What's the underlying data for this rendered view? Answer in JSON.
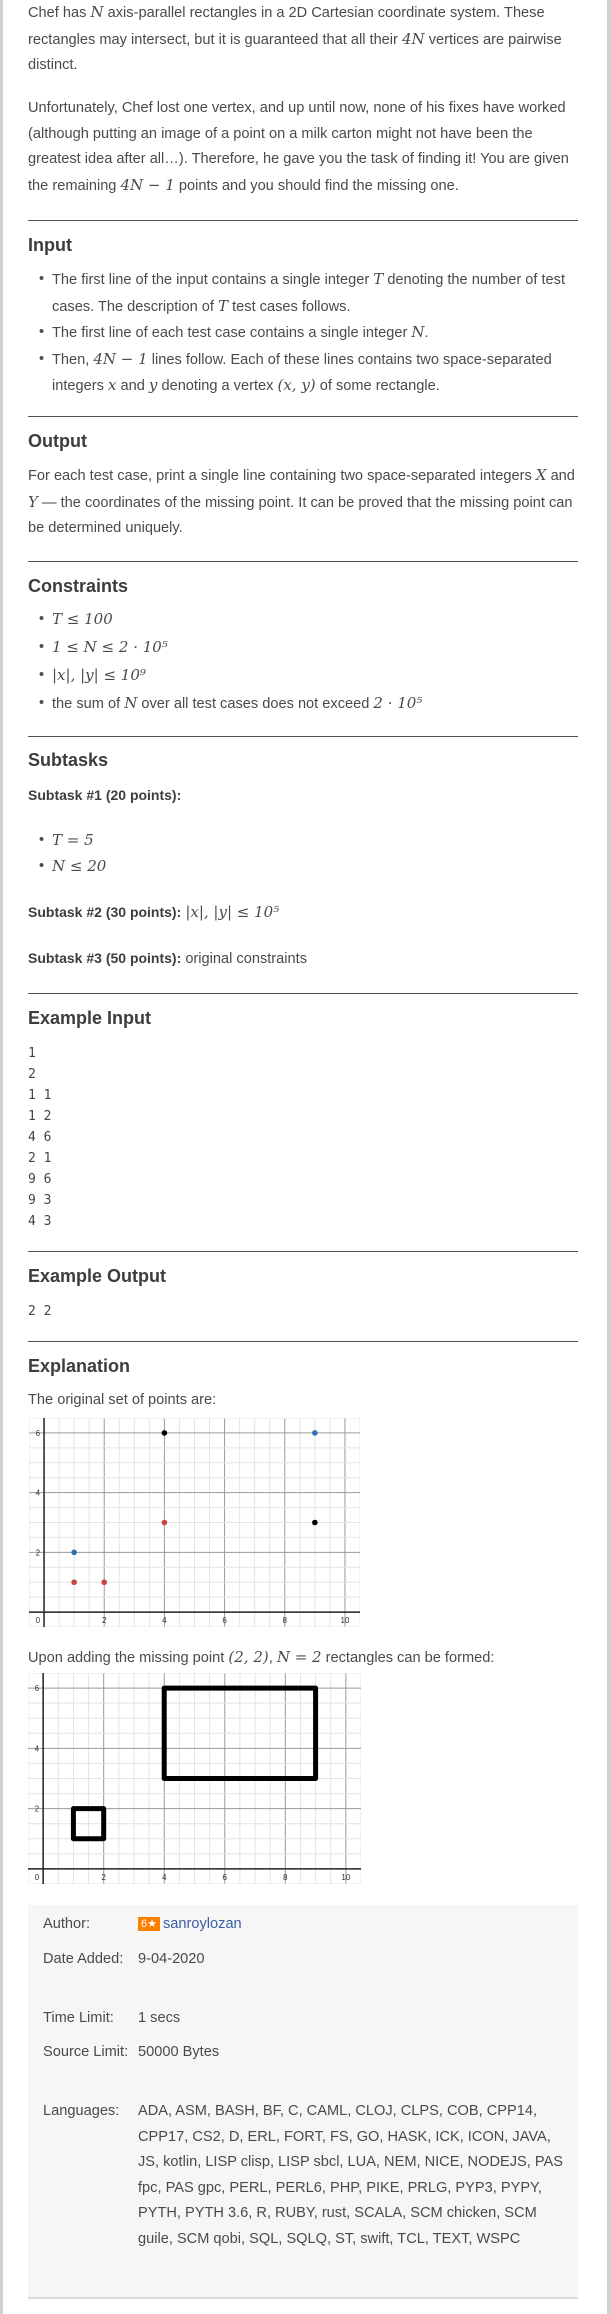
{
  "intro": {
    "p1": [
      "Chef has ",
      {
        "m": "N"
      },
      " axis-parallel rectangles in a 2D Cartesian coordinate system. These rectangles may intersect, but it is guaranteed that all their ",
      {
        "m": "4N"
      },
      " vertices are pairwise distinct."
    ],
    "p2": [
      "Unfortunately, Chef lost one vertex, and up until now, none of his fixes have worked (although putting an image of a point on a milk carton might not have been the greatest idea after all…). Therefore, he gave you the task of finding it! You are given the remaining ",
      {
        "m": "4N − 1"
      },
      " points and you should find the missing one."
    ]
  },
  "input": {
    "heading": "Input",
    "items": [
      [
        "The first line of the input contains a single integer ",
        {
          "m": "T"
        },
        " denoting the number of test cases. The description of ",
        {
          "m": "T"
        },
        " test cases follows."
      ],
      [
        "The first line of each test case contains a single integer ",
        {
          "m": "N"
        },
        "."
      ],
      [
        "Then, ",
        {
          "m": "4N − 1"
        },
        " lines follow. Each of these lines contains two space-separated integers ",
        {
          "m": "x"
        },
        " and ",
        {
          "m": "y"
        },
        " denoting a vertex ",
        {
          "m": "(x, y)"
        },
        " of some rectangle."
      ]
    ]
  },
  "output": {
    "heading": "Output",
    "p": [
      "For each test case, print a single line containing two space-separated integers ",
      {
        "m": "X"
      },
      " and ",
      {
        "m": "Y"
      },
      " — the coordinates of the missing point. It can be proved that the missing point can be determined uniquely."
    ]
  },
  "constraints": {
    "heading": "Constraints",
    "items": [
      [
        {
          "m": "T ≤ 100"
        }
      ],
      [
        {
          "m": "1 ≤ N ≤ 2 · 10⁵"
        }
      ],
      [
        {
          "m": "|x|, |y| ≤ 10⁹"
        }
      ],
      [
        "the sum of ",
        {
          "m": "N"
        },
        " over all test cases does not exceed ",
        {
          "m": "2 · 10⁵"
        }
      ]
    ]
  },
  "subtasks": {
    "heading": "Subtasks",
    "s1": {
      "label": "Subtask #1 (20 points):",
      "items": [
        [
          {
            "m": "T = 5"
          }
        ],
        [
          {
            "m": "N ≤ 20"
          }
        ]
      ]
    },
    "s2": {
      "label": "Subtask #2 (30 points):",
      "text": [
        " ",
        {
          "m": "|x|, |y| ≤ 10⁵"
        }
      ]
    },
    "s3": {
      "label": "Subtask #3 (50 points):",
      "text": [
        " original constraints"
      ]
    }
  },
  "example_input": {
    "heading": "Example Input",
    "text": "1\n2\n1 1\n1 2\n4 6\n2 1\n9 6\n9 3\n4 3"
  },
  "example_output": {
    "heading": "Example Output",
    "text": "2 2"
  },
  "explanation": {
    "heading": "Explanation",
    "p1": [
      "The original set of points are:"
    ],
    "p2": [
      "Upon adding the missing point ",
      {
        "m": "(2, 2)"
      },
      ", ",
      {
        "m": "N = 2"
      },
      " rectangles can be formed:"
    ]
  },
  "chart_data": [
    {
      "type": "scatter",
      "xlim": [
        -0.5,
        10.5
      ],
      "ylim": [
        -0.5,
        6.5
      ],
      "x_ticks": [
        "2",
        "4",
        "6",
        "8",
        "10"
      ],
      "y_ticks": [
        "2",
        "4",
        "6"
      ],
      "origin_label": "0",
      "grid": true,
      "points": [
        {
          "x": 1,
          "y": 2,
          "color": "#2d70b3"
        },
        {
          "x": 9,
          "y": 6,
          "color": "#2d70b3"
        },
        {
          "x": 1,
          "y": 1,
          "color": "#c74440"
        },
        {
          "x": 2,
          "y": 1,
          "color": "#c74440"
        },
        {
          "x": 4,
          "y": 3,
          "color": "#c74440"
        },
        {
          "x": 4,
          "y": 6,
          "color": "#000000"
        },
        {
          "x": 9,
          "y": 3,
          "color": "#000000"
        }
      ]
    },
    {
      "type": "rectangles",
      "xlim": [
        -0.5,
        10.5
      ],
      "ylim": [
        -0.5,
        6.5
      ],
      "x_ticks": [
        "2",
        "4",
        "6",
        "8",
        "10"
      ],
      "y_ticks": [
        "2",
        "4",
        "6"
      ],
      "origin_label": "0",
      "grid": true,
      "rectangles": [
        {
          "x1": 1,
          "y1": 1,
          "x2": 2,
          "y2": 2,
          "color": "#000000"
        },
        {
          "x1": 4,
          "y1": 3,
          "x2": 9,
          "y2": 6,
          "color": "#000000"
        }
      ]
    }
  ],
  "meta": {
    "author_label": "Author:",
    "author_badge": "6★",
    "author_name": "sanroylozan",
    "badge_color": "#ff7f00",
    "date_label": "Date Added:",
    "date_value": "9-04-2020",
    "time_label": "Time Limit:",
    "time_value": "1 secs",
    "source_label": "Source Limit:",
    "source_value": "50000 Bytes",
    "languages_label": "Languages:",
    "languages_value": "ADA, ASM, BASH, BF, C, CAML, CLOJ, CLPS, COB, CPP14, CPP17, CS2, D, ERL, FORT, FS, GO, HASK, ICK, ICON, JAVA, JS, kotlin, LISP clisp, LISP sbcl, LUA, NEM, NICE, NODEJS, PAS fpc, PAS gpc, PERL, PERL6, PHP, PIKE, PRLG, PYP3, PYPY, PYTH, PYTH 3.6, R, RUBY, rust, SCALA, SCM chicken, SCM guile, SCM qobi, SQL, SQLQ, ST, swift, TCL, TEXT, WSPC"
  }
}
